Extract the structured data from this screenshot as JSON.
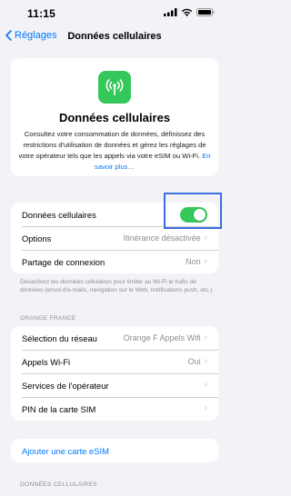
{
  "status_bar": {
    "time": "11:15"
  },
  "nav": {
    "back_label": "Réglages",
    "title": "Données cellulaires"
  },
  "header": {
    "title": "Données cellulaires",
    "description": "Consultez votre consommation de données, définissez des restrictions d'utilisation de données et gérez les réglages de votre opérateur tels que les appels via votre eSIM ou Wi-Fi.",
    "link": "En savoir plus…",
    "icon": "antenna-icon"
  },
  "main_group": {
    "cellular_data_label": "Données cellulaires",
    "cellular_data_on": true,
    "options_label": "Options",
    "options_value": "Itinérance désactivée",
    "hotspot_label": "Partage de connexion",
    "hotspot_value": "Non"
  },
  "main_footnote": "Désactivez les données cellulaires pour limiter au Wi-Fi le trafic de données (envoi d'e-mails, navigation sur le Web, notifications push, etc.).",
  "carrier_section": {
    "header": "ORANGE FRANCE",
    "network_label": "Sélection du réseau",
    "network_value": "Orange F Appels Wifi",
    "wifi_calls_label": "Appels Wi-Fi",
    "wifi_calls_value": "Oui",
    "carrier_services_label": "Services de l'opérateur",
    "sim_pin_label": "PIN de la carte SIM"
  },
  "esim": {
    "add_label": "Ajouter une carte eSIM"
  },
  "data_section": {
    "header": "DONNÉES CELLULAIRES"
  },
  "colors": {
    "accent": "#007aff",
    "toggle_on": "#34c759",
    "highlight": "#3b6fe0",
    "background": "#f2f2f7"
  }
}
